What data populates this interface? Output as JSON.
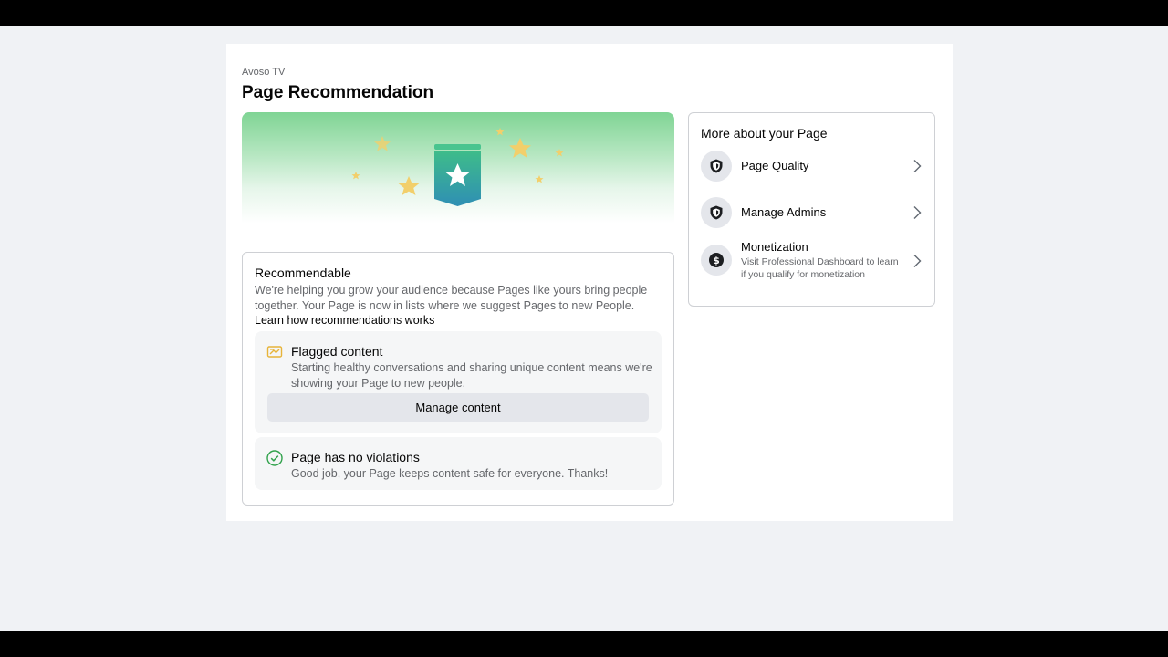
{
  "page": {
    "name": "Avoso TV",
    "title": "Page Recommendation"
  },
  "hero": {
    "icon": "badge-star-icon",
    "colors": {
      "gradient_top": "#7fd494",
      "badge_top": "#3ebc8a",
      "badge_bottom": "#2f8fb4",
      "stars": "#f2cf6b"
    }
  },
  "recommendable": {
    "title": "Recommendable",
    "description": "We're helping you grow your audience because Pages like yours bring people together. Your Page is now in lists where we suggest Pages to new People.",
    "link": "Learn how recommendations works",
    "flagged": {
      "icon": "flag-content-icon",
      "title": "Flagged content",
      "description": "Starting healthy conversations and sharing unique content means we're showing your Page to new people.",
      "button": "Manage content"
    },
    "violations": {
      "icon": "check-circle-icon",
      "title": "Page has no violations",
      "description": "Good job, your Page keeps content safe for everyone. Thanks!"
    }
  },
  "sidebar": {
    "title": "More about your Page",
    "items": [
      {
        "icon": "shield-icon",
        "label": "Page Quality"
      },
      {
        "icon": "shield-icon",
        "label": "Manage Admins"
      },
      {
        "icon": "dollar-icon",
        "label": "Monetization",
        "sub": "Visit Professional Dashboard to learn if you qualify for monetization"
      }
    ]
  }
}
